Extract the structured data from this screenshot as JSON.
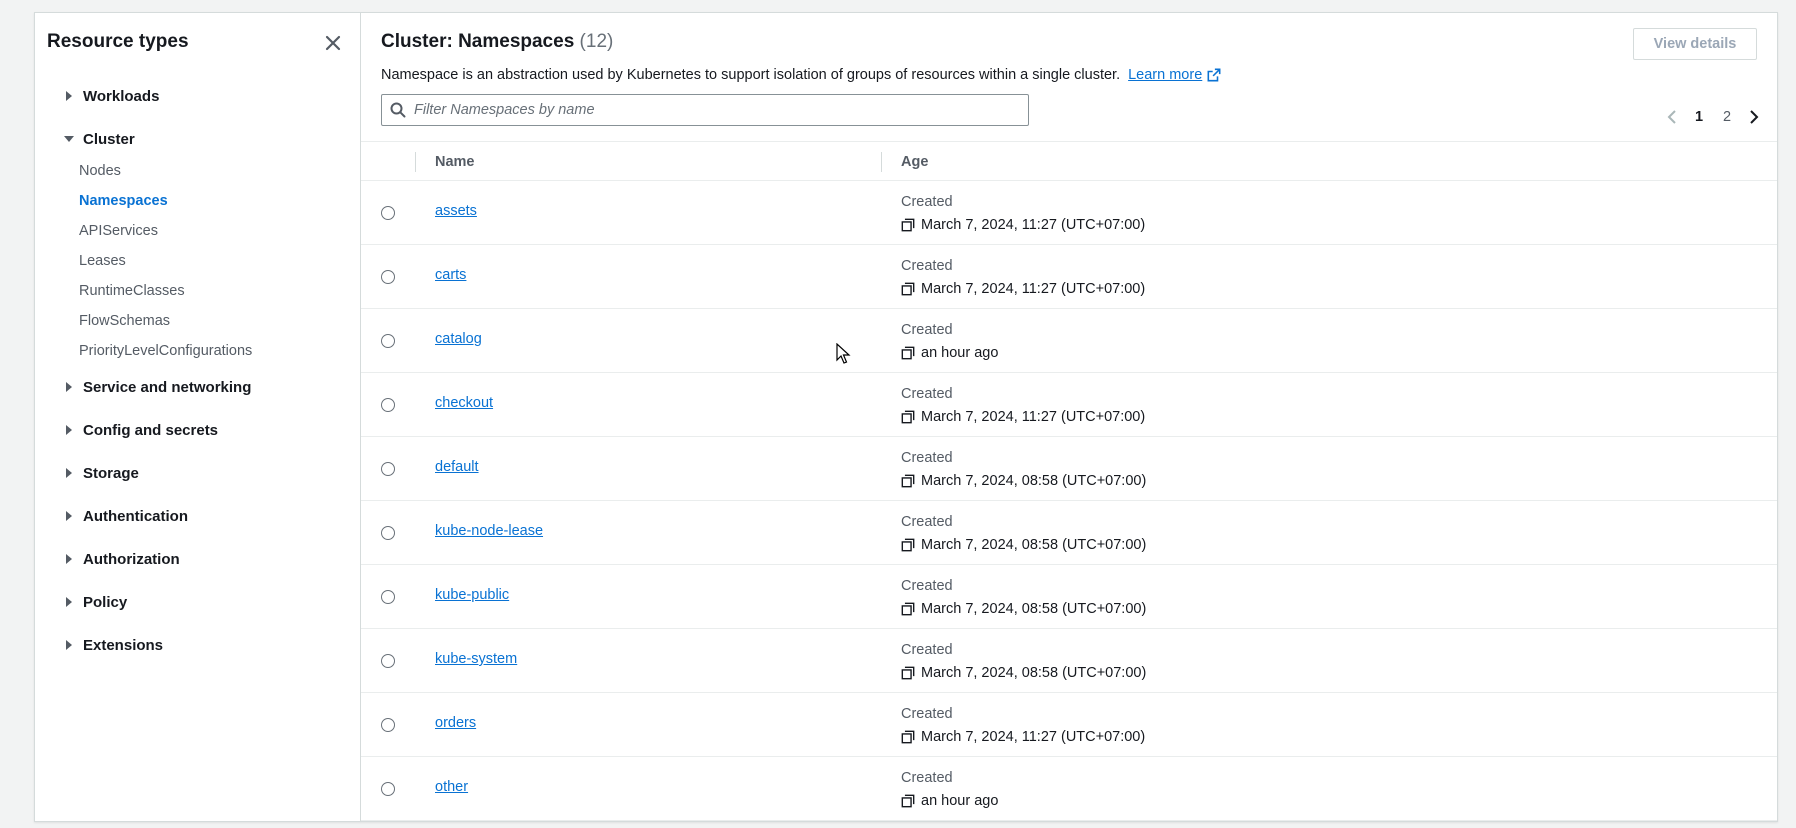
{
  "sidebar": {
    "title": "Resource types",
    "groups": [
      {
        "label": "Workloads",
        "open": false
      },
      {
        "label": "Cluster",
        "open": true,
        "items": [
          "Nodes",
          "Namespaces",
          "APIServices",
          "Leases",
          "RuntimeClasses",
          "FlowSchemas",
          "PriorityLevelConfigurations"
        ],
        "active": "Namespaces"
      },
      {
        "label": "Service and networking",
        "open": false
      },
      {
        "label": "Config and secrets",
        "open": false
      },
      {
        "label": "Storage",
        "open": false
      },
      {
        "label": "Authentication",
        "open": false
      },
      {
        "label": "Authorization",
        "open": false
      },
      {
        "label": "Policy",
        "open": false
      },
      {
        "label": "Extensions",
        "open": false
      }
    ]
  },
  "header": {
    "title": "Cluster: Namespaces",
    "count": "(12)",
    "description": "Namespace is an abstraction used by Kubernetes to support isolation of groups of resources within a single cluster.",
    "learn_more": "Learn more",
    "view_details": "View details"
  },
  "search": {
    "placeholder": "Filter Namespaces by name"
  },
  "pagination": {
    "pages": [
      "1",
      "2"
    ],
    "current": "1"
  },
  "table": {
    "columns": [
      "Name",
      "Age"
    ],
    "age_prefix": "Created",
    "rows": [
      {
        "name": "assets",
        "age": "March 7, 2024, 11:27 (UTC+07:00)"
      },
      {
        "name": "carts",
        "age": "March 7, 2024, 11:27 (UTC+07:00)"
      },
      {
        "name": "catalog",
        "age": "an hour ago"
      },
      {
        "name": "checkout",
        "age": "March 7, 2024, 11:27 (UTC+07:00)"
      },
      {
        "name": "default",
        "age": "March 7, 2024, 08:58 (UTC+07:00)"
      },
      {
        "name": "kube-node-lease",
        "age": "March 7, 2024, 08:58 (UTC+07:00)"
      },
      {
        "name": "kube-public",
        "age": "March 7, 2024, 08:58 (UTC+07:00)"
      },
      {
        "name": "kube-system",
        "age": "March 7, 2024, 08:58 (UTC+07:00)"
      },
      {
        "name": "orders",
        "age": "March 7, 2024, 11:27 (UTC+07:00)"
      },
      {
        "name": "other",
        "age": "an hour ago"
      }
    ]
  },
  "colors": {
    "link": "#0972d3",
    "text": "#16191f",
    "muted": "#545b64",
    "border": "#d5dbdb"
  },
  "icons": {
    "close": "close-icon",
    "search": "search-icon",
    "external": "external-link-icon",
    "copy": "copy-icon",
    "caret_right": "caret-right-icon",
    "caret_down": "caret-down-icon"
  }
}
